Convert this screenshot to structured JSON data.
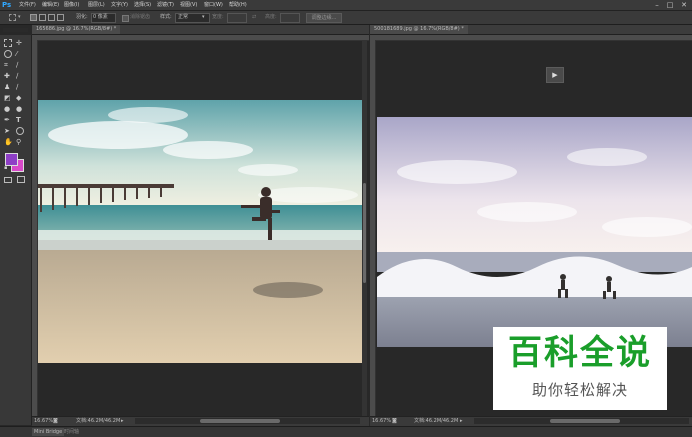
{
  "app": {
    "logo": "Ps"
  },
  "menu": [
    "文件(F)",
    "编辑(E)",
    "图像(I)",
    "图层(L)",
    "文字(Y)",
    "选择(S)",
    "滤镜(T)",
    "视图(V)",
    "窗口(W)",
    "帮助(H)"
  ],
  "window_controls": {
    "minimize": "–",
    "maximize": "□",
    "close": "✕"
  },
  "options": {
    "feather_label": "羽化:",
    "feather_value": "0 像素",
    "antialias_label": "消除锯齿",
    "style_label": "样式:",
    "style_value": "正常",
    "width_label": "宽度:",
    "height_label": "高度:",
    "refine_edge": "调整边缘..."
  },
  "documents": [
    {
      "tab": "165686.jpg @ 16.7%(RGB/8#) *",
      "zoom": "16.67%",
      "doc_size": "文档:46.2M/46.2M"
    },
    {
      "tab": "500181689.jpg @ 16.7%(RGB/8#) *",
      "zoom": "16.67%",
      "doc_size": "文档:46.2M/46.2M"
    }
  ],
  "bottom_tabs": [
    "Mini Bridge",
    "时间轴"
  ],
  "panel_collapsed_icon": "play-icon",
  "colors": {
    "foreground": "#8e3fc6",
    "background": "#d949c9",
    "accent": "#31a8ff"
  },
  "watermark": {
    "title": "百科全说",
    "subtitle": "助你轻松解决"
  }
}
